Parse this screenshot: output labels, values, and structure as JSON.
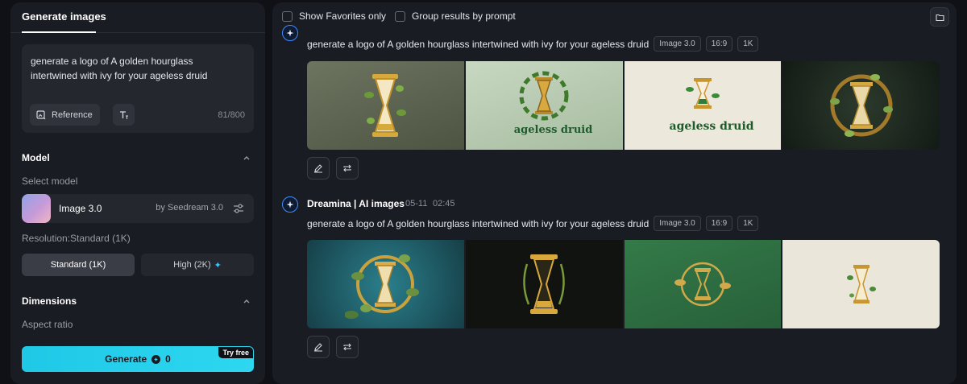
{
  "left_panel": {
    "tab_label": "Generate images",
    "prompt_text": "generate a logo of A golden hourglass intertwined with ivy for your ageless druid",
    "reference_label": "Reference",
    "char_counter": "81/800",
    "model_section_title": "Model",
    "select_model_label": "Select model",
    "model_name": "Image 3.0",
    "model_provider": "by Seedream 3.0",
    "resolution_label": "Resolution:Standard (1K)",
    "resolution_options": [
      "Standard (1K)",
      "High (2K)"
    ],
    "dimensions_title": "Dimensions",
    "aspect_ratio_label": "Aspect ratio",
    "generate_label": "Generate",
    "generate_cost": "0",
    "try_free_badge": "Try free",
    "accent_color": "#22cfea"
  },
  "right_panel": {
    "show_favorites_label": "Show Favorites only",
    "group_by_prompt_label": "Group results by prompt",
    "results": [
      {
        "author": "",
        "date": "",
        "time": "",
        "prompt": "generate a logo of A golden hourglass intertwined with ivy for your ageless druid",
        "chips": [
          "Image 3.0",
          "16:9",
          "1K"
        ],
        "images": [
          {
            "bg": "#5d6450",
            "brand": ""
          },
          {
            "bg": "#b6c9b1",
            "brand": "ageless druid"
          },
          {
            "bg": "#ece8dc",
            "brand": "ageless druid"
          },
          {
            "bg": "#1d2a22",
            "brand": ""
          }
        ]
      },
      {
        "author": "Dreamina | AI images",
        "date": "05-11",
        "time": "02:45",
        "prompt": "generate a logo of A golden hourglass intertwined with ivy for your ageless druid",
        "chips": [
          "Image 3.0",
          "16:9",
          "1K"
        ],
        "images": [
          {
            "bg": "#1d5a66",
            "brand": ""
          },
          {
            "bg": "#121410",
            "brand": ""
          },
          {
            "bg": "#2f7040",
            "brand": ""
          },
          {
            "bg": "#ebe6da",
            "brand": ""
          }
        ]
      }
    ]
  }
}
